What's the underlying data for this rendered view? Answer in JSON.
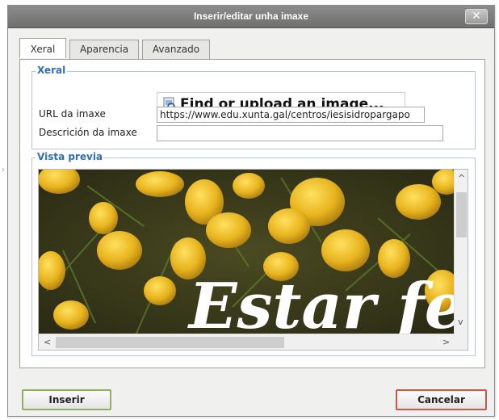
{
  "dialog": {
    "title": "Inserir/editar unha imaxe",
    "close_label": "✕"
  },
  "tabs": [
    {
      "label": "Xeral",
      "active": true
    },
    {
      "label": "Aparencia",
      "active": false
    },
    {
      "label": "Avanzado",
      "active": false
    }
  ],
  "general": {
    "legend": "Xeral",
    "find_button_label": "Find or upload an image...",
    "find_icon": "image-search-icon",
    "url_label": "URL da imaxe",
    "url_value": "https://www.edu.xunta.gal/centros/iesisidropargapo",
    "description_label": "Descrición da imaxe",
    "description_value": ""
  },
  "preview": {
    "legend": "Vista previa",
    "image_text": "Estar fe"
  },
  "scrollbars": {
    "up_arrow": "^",
    "down_arrow": "v",
    "left_arrow": "<",
    "right_arrow": ">"
  },
  "buttons": {
    "insert_label": "Inserir",
    "cancel_label": "Cancelar"
  },
  "colors": {
    "legend_blue": "#2c6fb5",
    "insert_border": "#8fb060",
    "cancel_border": "#c25a4a",
    "titlebar": "#7a7a7a"
  }
}
